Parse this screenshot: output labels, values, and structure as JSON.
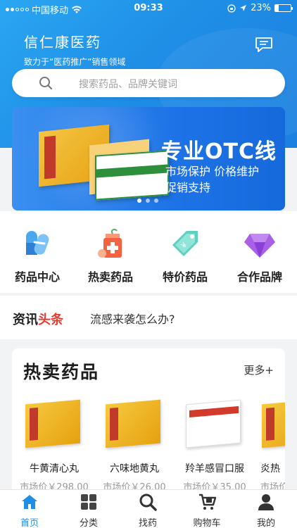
{
  "status_bar": {
    "carrier": "中国移动",
    "time": "09:33",
    "battery": "23%",
    "battery_level": 0.23
  },
  "header": {
    "brand_name": "信仁康医药",
    "slogan": "致力于“医药推广”销售领域"
  },
  "search": {
    "placeholder": "搜索药品、品牌关键词"
  },
  "banner": {
    "headline": "专业OTC线",
    "line1": "市场保护 价格维护",
    "line2": "促销支持",
    "slide_count": 3,
    "active_slide": 1
  },
  "categories": [
    {
      "label": "药品中心",
      "icon": "capsule-icon"
    },
    {
      "label": "热卖药品",
      "icon": "medicine-bottle-icon"
    },
    {
      "label": "特价药品",
      "icon": "price-tag-icon"
    },
    {
      "label": "合作品牌",
      "icon": "diamond-icon"
    }
  ],
  "news": {
    "tag_prefix": "资讯",
    "tag_highlight": "头条",
    "headline": "流感来袭怎么办?"
  },
  "hot": {
    "title": "热卖药品",
    "more": "更多+",
    "products": [
      {
        "name": "牛黄清心丸",
        "price": "市场价￥298.00"
      },
      {
        "name": "六味地黄丸",
        "price": "市场价￥26.00"
      },
      {
        "name": "羚羊感冒口服",
        "price": "市场价￥35.00"
      },
      {
        "name": "炎热",
        "price": "市场价"
      }
    ]
  },
  "tabbar": [
    {
      "label": "首页",
      "icon": "home-icon",
      "active": true
    },
    {
      "label": "分类",
      "icon": "grid-icon",
      "active": false
    },
    {
      "label": "找药",
      "icon": "search-icon",
      "active": false
    },
    {
      "label": "购物车",
      "icon": "cart-icon",
      "active": false
    },
    {
      "label": "我的",
      "icon": "user-icon",
      "active": false
    }
  ],
  "colors": {
    "primary": "#1f8fe6",
    "accent": "#e83a2e"
  }
}
